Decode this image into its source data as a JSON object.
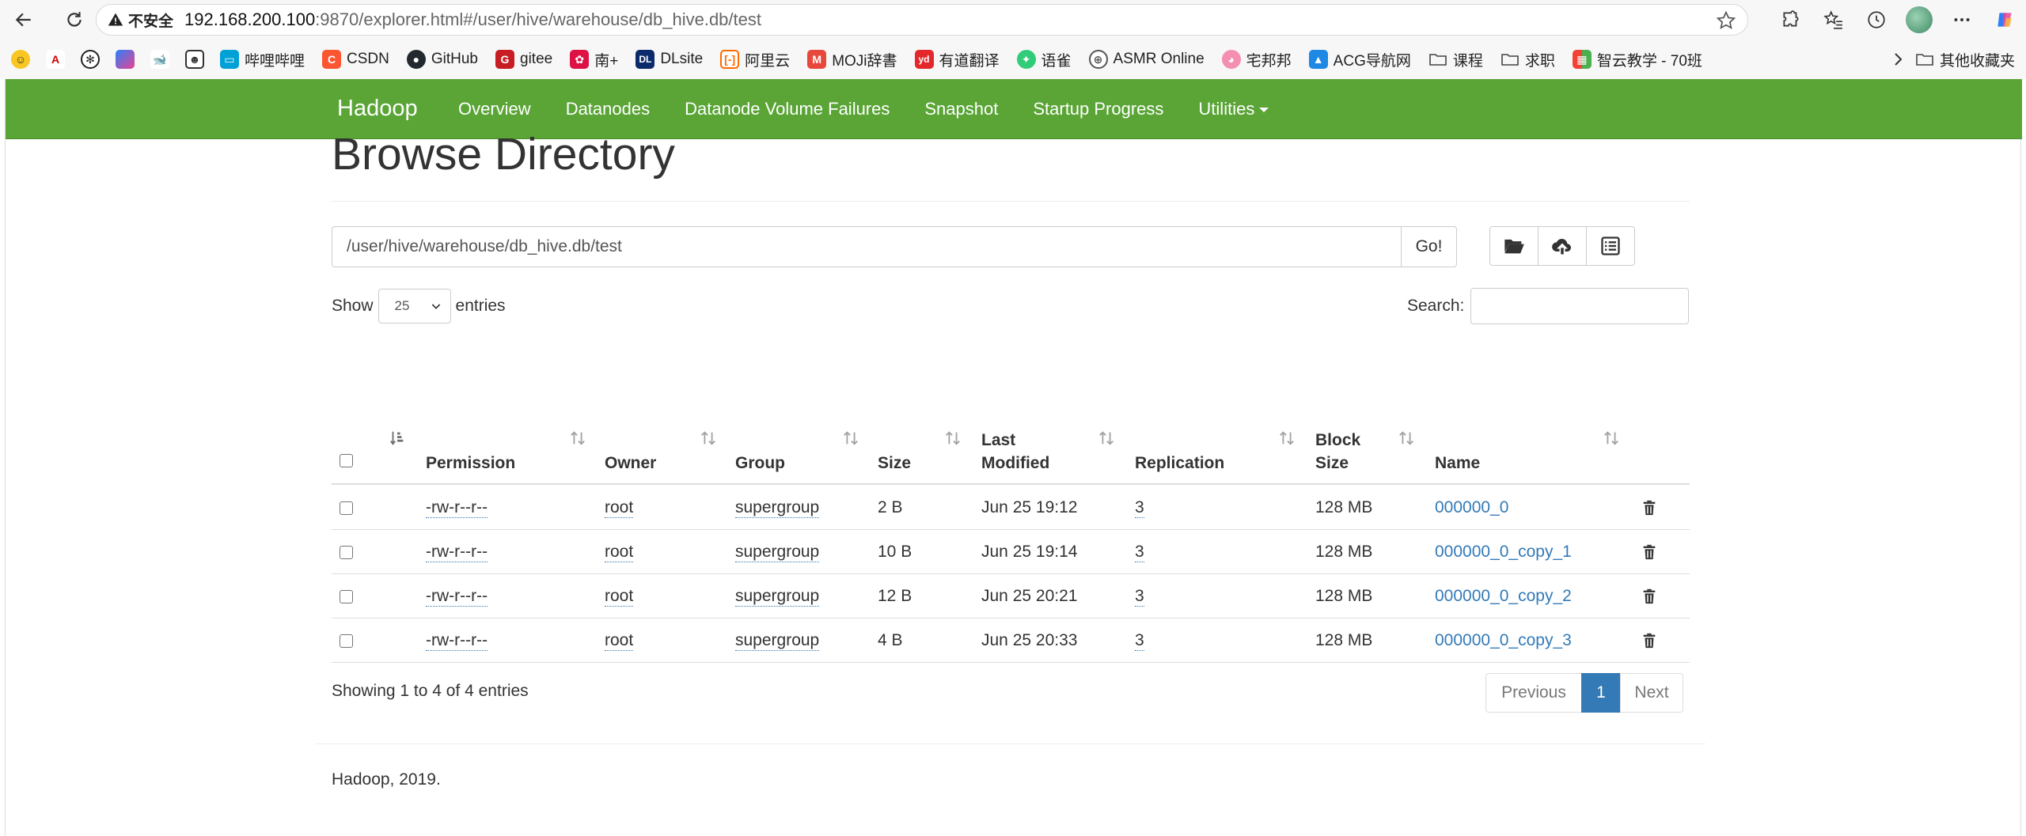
{
  "browser": {
    "security_label": "不安全",
    "url_host": "192.168.200.100",
    "url_rest": ":9870/explorer.html#/user/hive/warehouse/db_hive.db/test"
  },
  "bookmarks": {
    "items": [
      {
        "label": "哔哩哔哩",
        "icon": "bilibili-icon",
        "color": "#00a1d6"
      },
      {
        "label": "CSDN",
        "icon": "csdn-icon",
        "color": "#fc5531"
      },
      {
        "label": "GitHub",
        "icon": "github-icon",
        "color": "#24292f"
      },
      {
        "label": "gitee",
        "icon": "gitee-icon",
        "color": "#c71d23"
      },
      {
        "label": "南+",
        "icon": "south-plus-icon",
        "color": "#d14"
      },
      {
        "label": "DLsite",
        "icon": "dlsite-icon",
        "color": "#0a2a6b"
      },
      {
        "label": "阿里云",
        "icon": "aliyun-icon",
        "color": "#ff6a00"
      },
      {
        "label": "MOJi辞書",
        "icon": "moji-icon",
        "color": "#e8483b"
      },
      {
        "label": "有道翻译",
        "icon": "youdao-icon",
        "color": "#e3272b"
      },
      {
        "label": "语雀",
        "icon": "yuque-icon",
        "color": "#31cc79"
      },
      {
        "label": "ASMR Online",
        "icon": "globe-icon",
        "color": "#555555"
      },
      {
        "label": "宅邦邦",
        "icon": "zhaibangbang-icon",
        "color": "#f48fb1"
      },
      {
        "label": "ACG导航网",
        "icon": "acg-icon",
        "color": "#1e88e5"
      },
      {
        "label": "课程",
        "icon": "folder-icon",
        "color": "#555555"
      },
      {
        "label": "求职",
        "icon": "folder-icon",
        "color": "#555555"
      },
      {
        "label": "智云教学 - 70班",
        "icon": "zhiyun-icon",
        "color": "#4caf50"
      }
    ],
    "other_label": "其他收藏夹"
  },
  "navbar": {
    "brand": "Hadoop",
    "links": [
      "Overview",
      "Datanodes",
      "Datanode Volume Failures",
      "Snapshot",
      "Startup Progress",
      "Utilities"
    ],
    "color": "#5aa536"
  },
  "page": {
    "title": "Browse Directory",
    "path_value": "/user/hive/warehouse/db_hive.db/test",
    "go_label": "Go!",
    "show_label": "Show",
    "entries_count": "25",
    "entries_label": "entries",
    "search_label": "Search:"
  },
  "table": {
    "headers": [
      "Permission",
      "Owner",
      "Group",
      "Size",
      "Last Modified",
      "Replication",
      "Block Size",
      "Name"
    ],
    "header_lines": {
      "last_modified": [
        "Last",
        "Modified"
      ],
      "block_size": [
        "Block",
        "Size"
      ]
    },
    "rows": [
      {
        "permission": "-rw-r--r--",
        "owner": "root",
        "group": "supergroup",
        "size": "2 B",
        "modified": "Jun 25 19:12",
        "replication": "3",
        "block_size": "128 MB",
        "name": "000000_0"
      },
      {
        "permission": "-rw-r--r--",
        "owner": "root",
        "group": "supergroup",
        "size": "10 B",
        "modified": "Jun 25 19:14",
        "replication": "3",
        "block_size": "128 MB",
        "name": "000000_0_copy_1"
      },
      {
        "permission": "-rw-r--r--",
        "owner": "root",
        "group": "supergroup",
        "size": "12 B",
        "modified": "Jun 25 20:21",
        "replication": "3",
        "block_size": "128 MB",
        "name": "000000_0_copy_2"
      },
      {
        "permission": "-rw-r--r--",
        "owner": "root",
        "group": "supergroup",
        "size": "4 B",
        "modified": "Jun 25 20:33",
        "replication": "3",
        "block_size": "128 MB",
        "name": "000000_0_copy_3"
      }
    ]
  },
  "pagination": {
    "info": "Showing 1 to 4 of 4 entries",
    "previous": "Previous",
    "current": "1",
    "next": "Next"
  },
  "footer": {
    "text": "Hadoop, 2019."
  }
}
